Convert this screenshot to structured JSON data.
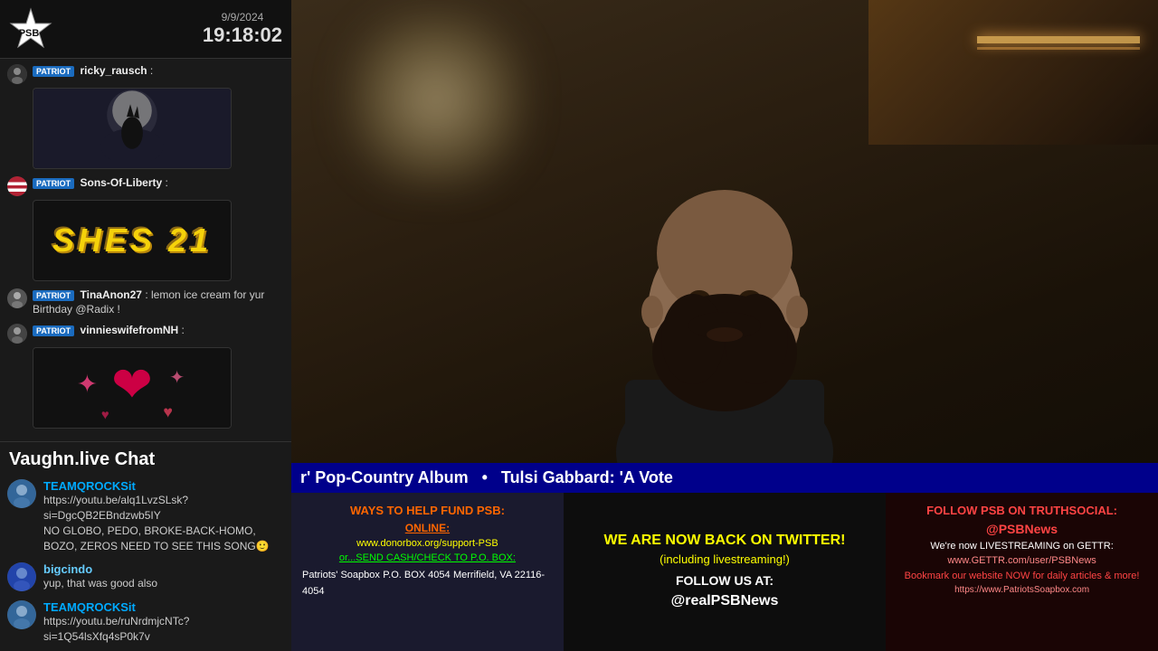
{
  "header": {
    "logo_text": "PSB",
    "date": "9/9/2024",
    "time": "19:18:02"
  },
  "sidebar_upper": {
    "messages": [
      {
        "id": "msg1",
        "badge": "PATRIOT",
        "username": "ricky_rausch",
        "colon": " :",
        "text": "",
        "has_image": true,
        "image_type": "wolf_moon"
      },
      {
        "id": "msg2",
        "badge": "PATRIOT",
        "username": "Sons-Of-Liberty",
        "colon": " :",
        "text": "SHES 21",
        "has_image": false,
        "image_type": "shes21"
      },
      {
        "id": "msg3",
        "badge": "PATRIOT",
        "username": "TinaAnon27",
        "colon": " :",
        "text": "lemon ice cream for yur Birthday @Radix !",
        "has_image": false
      },
      {
        "id": "msg4",
        "badge": "PATRIOT",
        "username": "vinnieswifefromNH",
        "colon": " :",
        "text": "",
        "has_image": true,
        "image_type": "hearts"
      }
    ]
  },
  "vaughn_chat_label": "Vaughn.live Chat",
  "vaughn_messages": [
    {
      "id": "vm1",
      "username": "TEAMQROCKSit",
      "username_color": "#00aaff",
      "text": "https://youtu.be/alq1LvzSLsk?si=DgcQB2EBndzwb5IY\nNO GLOBO, PEDO, BROKE-BACK-HOMO, BOZO, ZEROS NEED TO SEE THIS SONG🙂",
      "avatar_color": "#336699"
    },
    {
      "id": "vm2",
      "username": "bigcindo",
      "username_color": "#66ccff",
      "text": "yup, that was good also",
      "avatar_color": "#2244aa"
    },
    {
      "id": "vm3",
      "username": "TEAMQROCKSit",
      "username_color": "#00aaff",
      "text": "https://youtu.be/ruNrdmjcNTc?si=1Q54lsXfq4sP0k7v",
      "avatar_color": "#336699"
    }
  ],
  "ticker": {
    "text": "r&#039; Pop-Country Album  •  Tulsi Gabbard: &#039;A Vote"
  },
  "panel_left": {
    "title": "WAYS TO HELP FUND PSB:",
    "online_label": "ONLINE:",
    "donate_url": "www.donorbox.org/support-PSB",
    "or_send": "or...SEND CASH/CHECK TO P.O. BOX:",
    "org_name": "Patriots' Soapbox",
    "po_box": "P.O. BOX 4054",
    "city": "Merrifield, VA 22116-4054"
  },
  "panel_center": {
    "line1": "WE ARE NOW BACK ON TWITTER!",
    "line2": "(including livestreaming!)",
    "line3": "FOLLOW US AT:",
    "handle": "@realPSBNews"
  },
  "panel_right": {
    "title": "FOLLOW PSB ON TRUTHSOCIAL:",
    "handle": "@PSBNews",
    "livestream": "We're now LIVESTREAMING on GETTR:",
    "gettr_url": "www.GETTR.com/user/PSBNews",
    "bookmark": "Bookmark our website NOW for daily articles & more!",
    "website": "https://www.PatriotsSoapbox.com"
  }
}
